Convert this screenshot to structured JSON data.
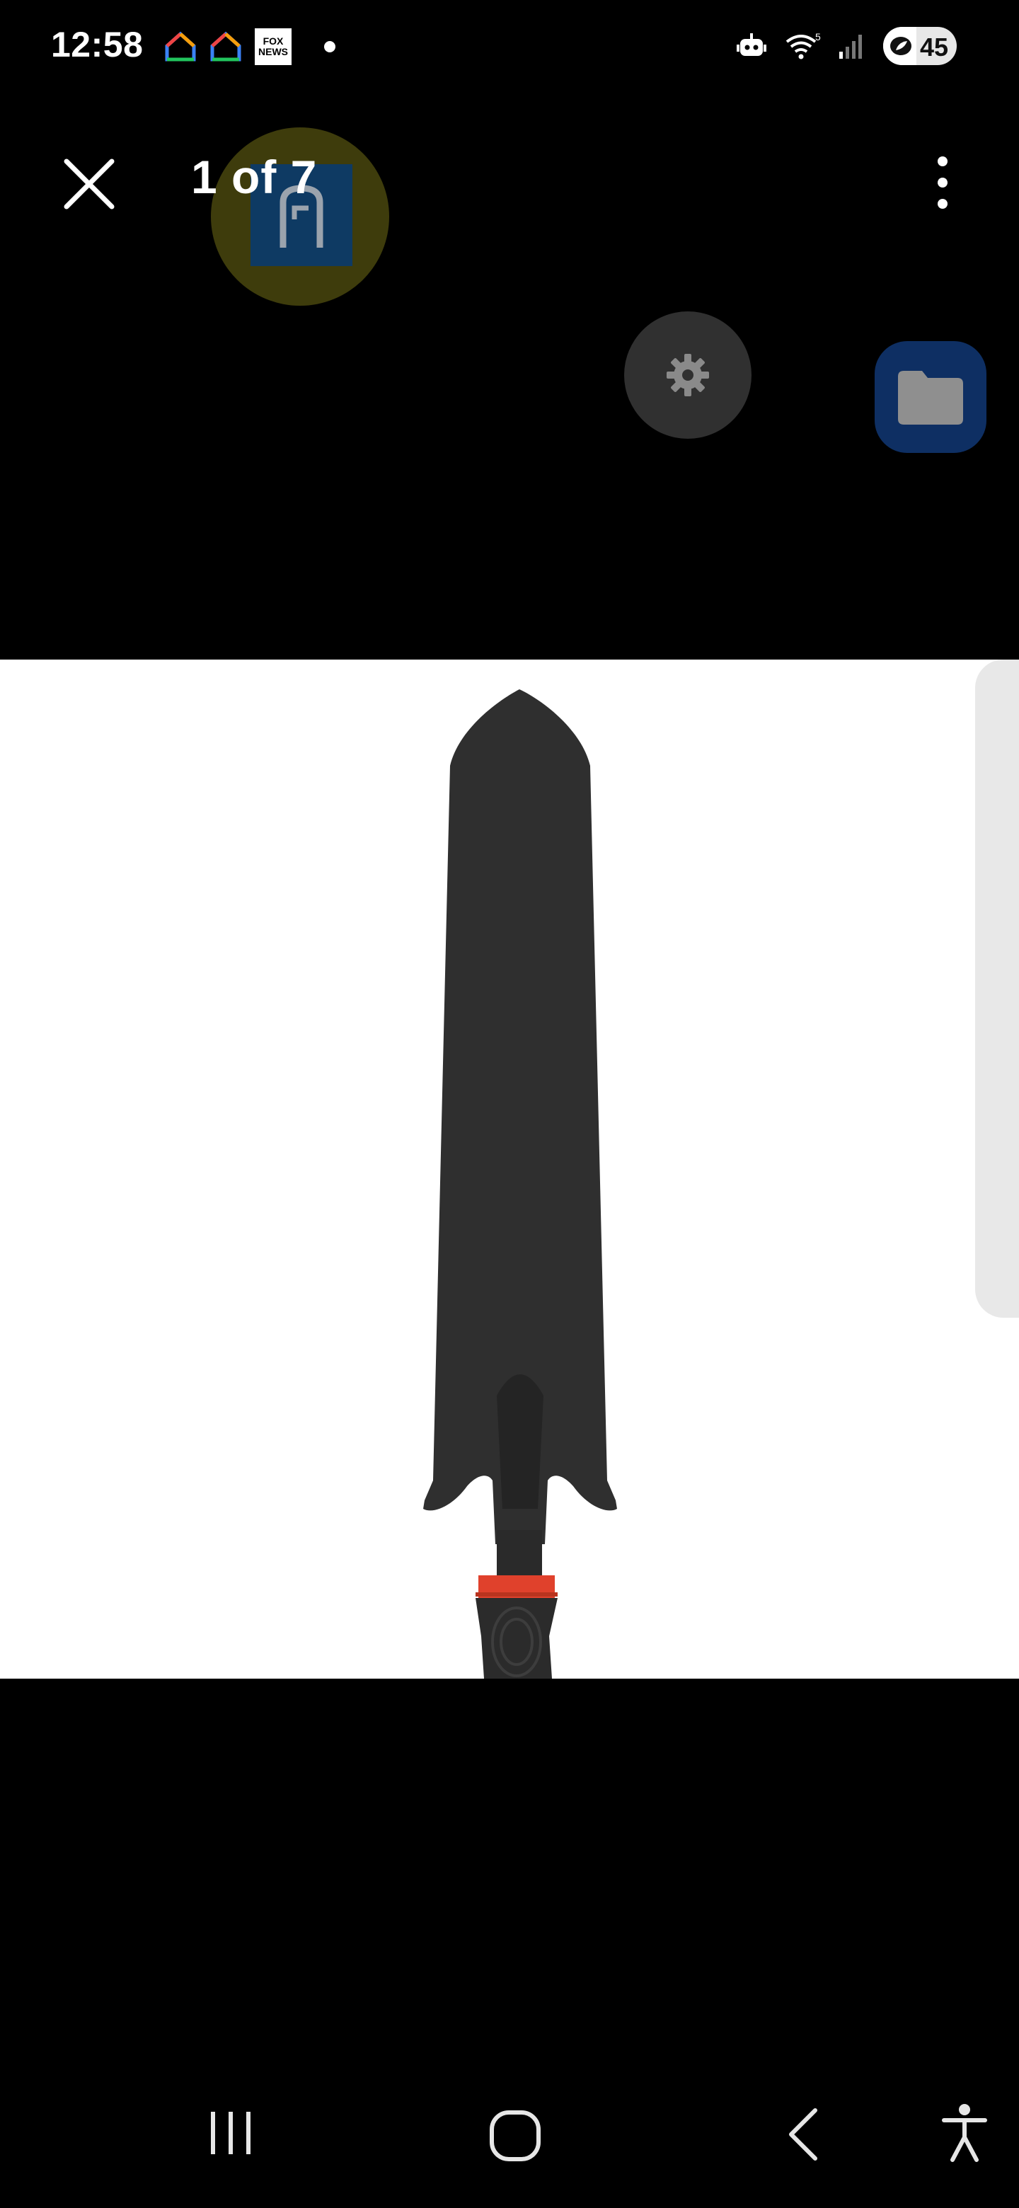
{
  "status_bar": {
    "time": "12:58",
    "notification_icons": [
      "smart-home-icon",
      "smart-home-icon",
      "fox-news-icon",
      "dot-icon"
    ],
    "fox_news_label": "FOX NEWS",
    "system_icons": [
      "robot-icon",
      "wifi-icon",
      "signal-icon",
      "battery-icon"
    ],
    "wifi_badge": "5",
    "battery_level": "45"
  },
  "toolbar": {
    "counter": "1 of 7",
    "close_icon": "close-icon",
    "more_icon": "more-vertical-icon"
  },
  "floating_buttons": [
    {
      "name": "yellow-bubble",
      "icon": "phone-booth-icon"
    },
    {
      "name": "gear-bubble",
      "icon": "gear-icon"
    },
    {
      "name": "folder-bubble",
      "icon": "folder-icon"
    }
  ],
  "image": {
    "subject": "garden-trowel",
    "colors": {
      "blade": "#2f2f2f",
      "handle": "#2b2b2b",
      "collar": "#e0412c",
      "background": "#ffffff"
    }
  },
  "nav_bar": {
    "buttons": [
      "recents-icon",
      "home-icon",
      "back-icon",
      "accessibility-icon"
    ]
  }
}
